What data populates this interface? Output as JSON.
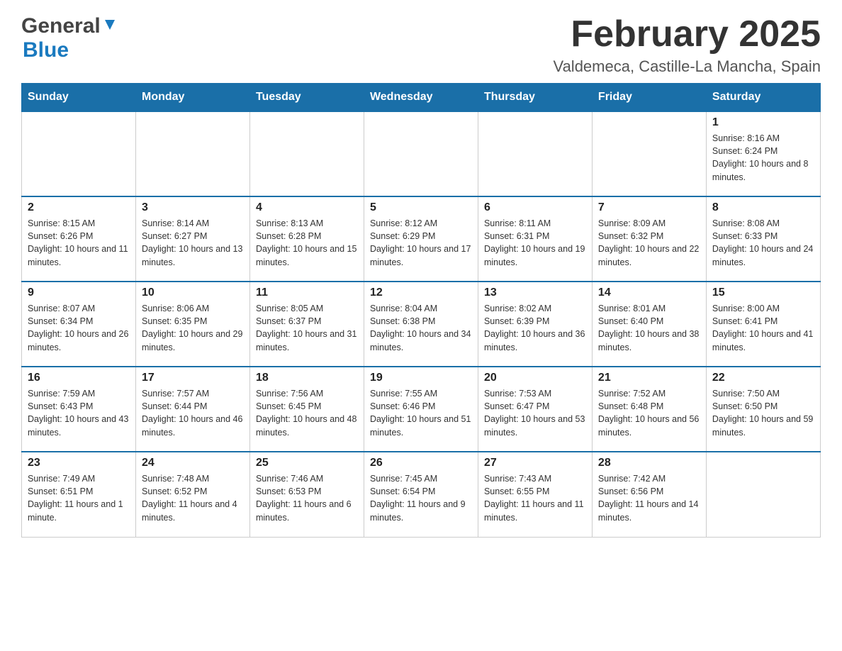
{
  "logo": {
    "general": "General",
    "blue": "Blue"
  },
  "title": "February 2025",
  "subtitle": "Valdemeca, Castille-La Mancha, Spain",
  "days_of_week": [
    "Sunday",
    "Monday",
    "Tuesday",
    "Wednesday",
    "Thursday",
    "Friday",
    "Saturday"
  ],
  "weeks": [
    {
      "days": [
        {
          "number": "",
          "info": ""
        },
        {
          "number": "",
          "info": ""
        },
        {
          "number": "",
          "info": ""
        },
        {
          "number": "",
          "info": ""
        },
        {
          "number": "",
          "info": ""
        },
        {
          "number": "",
          "info": ""
        },
        {
          "number": "1",
          "info": "Sunrise: 8:16 AM\nSunset: 6:24 PM\nDaylight: 10 hours and 8 minutes."
        }
      ]
    },
    {
      "days": [
        {
          "number": "2",
          "info": "Sunrise: 8:15 AM\nSunset: 6:26 PM\nDaylight: 10 hours and 11 minutes."
        },
        {
          "number": "3",
          "info": "Sunrise: 8:14 AM\nSunset: 6:27 PM\nDaylight: 10 hours and 13 minutes."
        },
        {
          "number": "4",
          "info": "Sunrise: 8:13 AM\nSunset: 6:28 PM\nDaylight: 10 hours and 15 minutes."
        },
        {
          "number": "5",
          "info": "Sunrise: 8:12 AM\nSunset: 6:29 PM\nDaylight: 10 hours and 17 minutes."
        },
        {
          "number": "6",
          "info": "Sunrise: 8:11 AM\nSunset: 6:31 PM\nDaylight: 10 hours and 19 minutes."
        },
        {
          "number": "7",
          "info": "Sunrise: 8:09 AM\nSunset: 6:32 PM\nDaylight: 10 hours and 22 minutes."
        },
        {
          "number": "8",
          "info": "Sunrise: 8:08 AM\nSunset: 6:33 PM\nDaylight: 10 hours and 24 minutes."
        }
      ]
    },
    {
      "days": [
        {
          "number": "9",
          "info": "Sunrise: 8:07 AM\nSunset: 6:34 PM\nDaylight: 10 hours and 26 minutes."
        },
        {
          "number": "10",
          "info": "Sunrise: 8:06 AM\nSunset: 6:35 PM\nDaylight: 10 hours and 29 minutes."
        },
        {
          "number": "11",
          "info": "Sunrise: 8:05 AM\nSunset: 6:37 PM\nDaylight: 10 hours and 31 minutes."
        },
        {
          "number": "12",
          "info": "Sunrise: 8:04 AM\nSunset: 6:38 PM\nDaylight: 10 hours and 34 minutes."
        },
        {
          "number": "13",
          "info": "Sunrise: 8:02 AM\nSunset: 6:39 PM\nDaylight: 10 hours and 36 minutes."
        },
        {
          "number": "14",
          "info": "Sunrise: 8:01 AM\nSunset: 6:40 PM\nDaylight: 10 hours and 38 minutes."
        },
        {
          "number": "15",
          "info": "Sunrise: 8:00 AM\nSunset: 6:41 PM\nDaylight: 10 hours and 41 minutes."
        }
      ]
    },
    {
      "days": [
        {
          "number": "16",
          "info": "Sunrise: 7:59 AM\nSunset: 6:43 PM\nDaylight: 10 hours and 43 minutes."
        },
        {
          "number": "17",
          "info": "Sunrise: 7:57 AM\nSunset: 6:44 PM\nDaylight: 10 hours and 46 minutes."
        },
        {
          "number": "18",
          "info": "Sunrise: 7:56 AM\nSunset: 6:45 PM\nDaylight: 10 hours and 48 minutes."
        },
        {
          "number": "19",
          "info": "Sunrise: 7:55 AM\nSunset: 6:46 PM\nDaylight: 10 hours and 51 minutes."
        },
        {
          "number": "20",
          "info": "Sunrise: 7:53 AM\nSunset: 6:47 PM\nDaylight: 10 hours and 53 minutes."
        },
        {
          "number": "21",
          "info": "Sunrise: 7:52 AM\nSunset: 6:48 PM\nDaylight: 10 hours and 56 minutes."
        },
        {
          "number": "22",
          "info": "Sunrise: 7:50 AM\nSunset: 6:50 PM\nDaylight: 10 hours and 59 minutes."
        }
      ]
    },
    {
      "days": [
        {
          "number": "23",
          "info": "Sunrise: 7:49 AM\nSunset: 6:51 PM\nDaylight: 11 hours and 1 minute."
        },
        {
          "number": "24",
          "info": "Sunrise: 7:48 AM\nSunset: 6:52 PM\nDaylight: 11 hours and 4 minutes."
        },
        {
          "number": "25",
          "info": "Sunrise: 7:46 AM\nSunset: 6:53 PM\nDaylight: 11 hours and 6 minutes."
        },
        {
          "number": "26",
          "info": "Sunrise: 7:45 AM\nSunset: 6:54 PM\nDaylight: 11 hours and 9 minutes."
        },
        {
          "number": "27",
          "info": "Sunrise: 7:43 AM\nSunset: 6:55 PM\nDaylight: 11 hours and 11 minutes."
        },
        {
          "number": "28",
          "info": "Sunrise: 7:42 AM\nSunset: 6:56 PM\nDaylight: 11 hours and 14 minutes."
        },
        {
          "number": "",
          "info": ""
        }
      ]
    }
  ]
}
